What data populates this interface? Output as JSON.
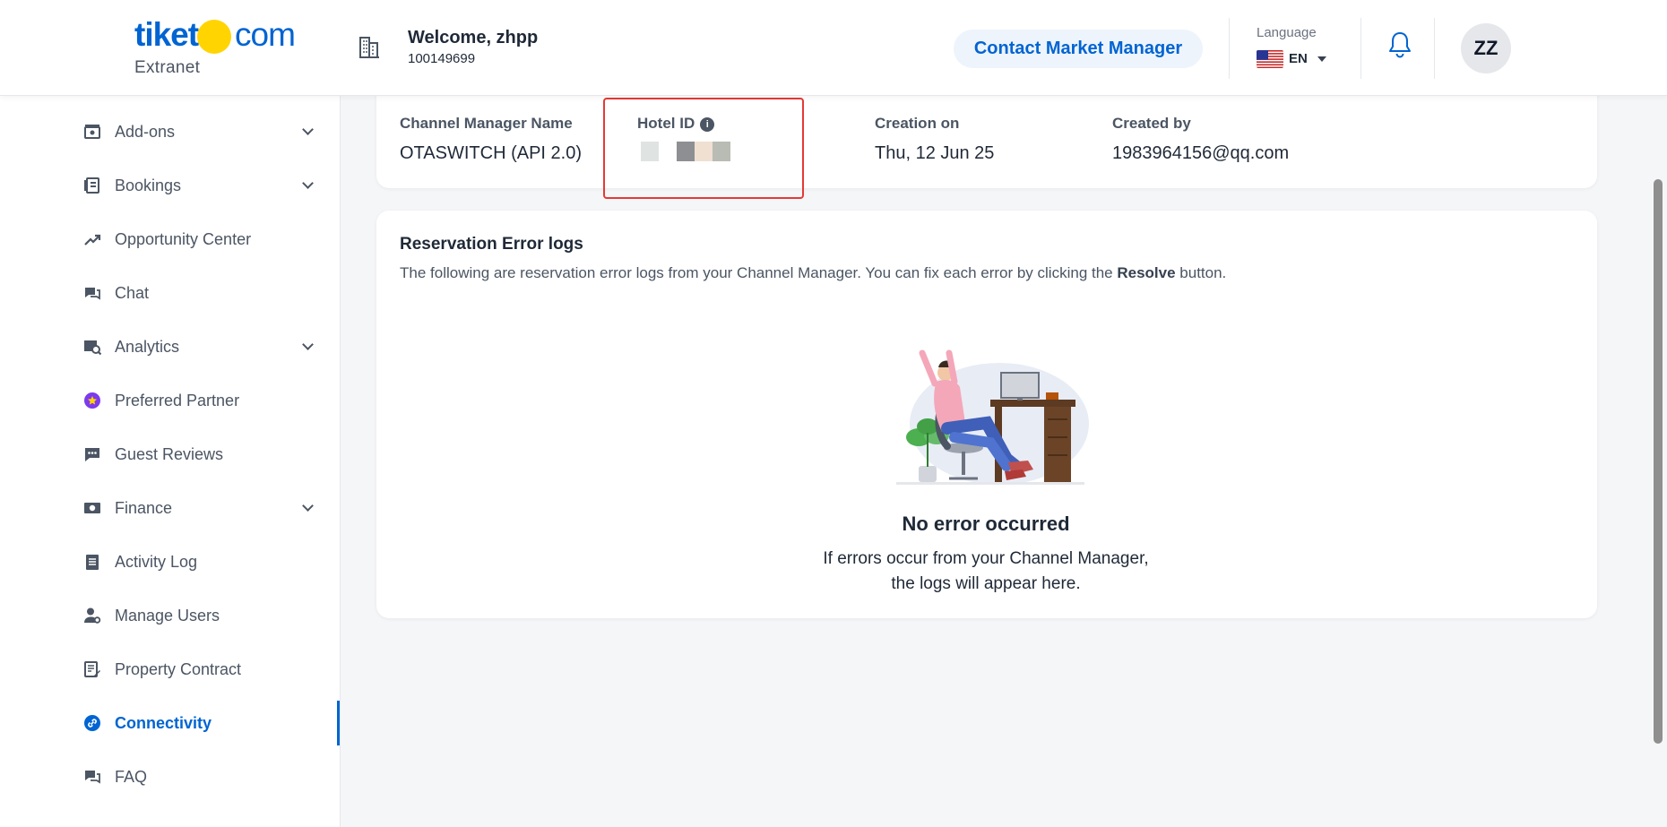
{
  "brand": {
    "name_left": "tiket",
    "name_right": "com",
    "subtitle": "Extranet"
  },
  "header": {
    "welcome": "Welcome, zhpp",
    "hotel_code": "100149699",
    "contact_button": "Contact Market Manager",
    "language_label": "Language",
    "language_code": "EN",
    "avatar_initials": "ZZ"
  },
  "sidebar": {
    "items": [
      {
        "label": "Add-ons",
        "icon": "addons-icon",
        "expandable": true
      },
      {
        "label": "Bookings",
        "icon": "bookings-icon",
        "expandable": true
      },
      {
        "label": "Opportunity Center",
        "icon": "trending-up-icon",
        "expandable": false
      },
      {
        "label": "Chat",
        "icon": "chat-icon",
        "expandable": false
      },
      {
        "label": "Analytics",
        "icon": "analytics-icon",
        "expandable": true
      },
      {
        "label": "Preferred Partner",
        "icon": "badge-icon",
        "expandable": false
      },
      {
        "label": "Guest Reviews",
        "icon": "review-icon",
        "expandable": false
      },
      {
        "label": "Finance",
        "icon": "money-icon",
        "expandable": true
      },
      {
        "label": "Activity Log",
        "icon": "clipboard-icon",
        "expandable": false
      },
      {
        "label": "Manage Users",
        "icon": "user-gear-icon",
        "expandable": false
      },
      {
        "label": "Property Contract",
        "icon": "contract-icon",
        "expandable": false
      },
      {
        "label": "Connectivity",
        "icon": "link-icon",
        "expandable": false,
        "active": true
      },
      {
        "label": "FAQ",
        "icon": "faq-icon",
        "expandable": false
      }
    ]
  },
  "channel_info": {
    "manager_name_label": "Channel Manager Name",
    "manager_name_value": "OTASWITCH (API 2.0)",
    "hotel_id_label": "Hotel ID",
    "creation_label": "Creation on",
    "creation_value": "Thu, 12 Jun 25",
    "created_by_label": "Created by",
    "created_by_value": "1983964156@qq.com"
  },
  "logs": {
    "title": "Reservation Error logs",
    "desc_prefix": "The following are reservation error logs from your Channel Manager. You can fix each error by clicking the ",
    "desc_bold": "Resolve",
    "desc_suffix": " button.",
    "empty_title": "No error occurred",
    "empty_line1": "If errors occur from your Channel Manager,",
    "empty_line2": "the logs will appear here."
  },
  "colors": {
    "brand_blue": "#0064d2",
    "brand_yellow": "#ffd400",
    "highlight_red": "#e53935"
  }
}
